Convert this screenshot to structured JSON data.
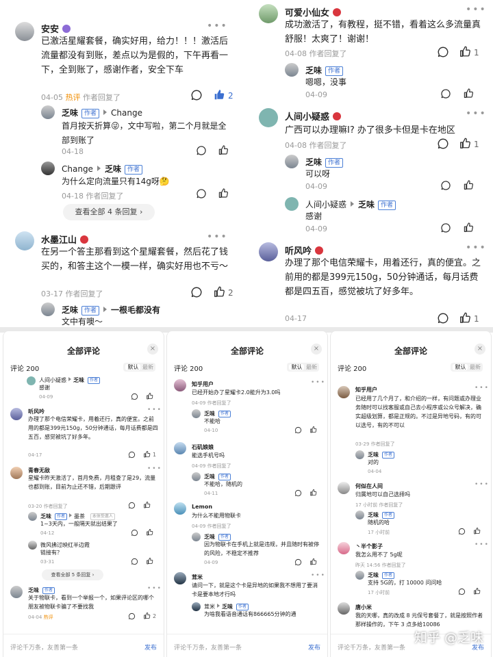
{
  "top_left": {
    "c1": {
      "name": "安安",
      "text": "已激活星耀套餐，确实好用，给力！！！激活后流量都没有到账，差点以为是假的，下午再看一下，全到账了，感谢作者，安全下车",
      "date": "04-05",
      "hot": "热评",
      "replied": "作者回复了",
      "likes": "2"
    },
    "r1": {
      "from": "乏味",
      "badge": "作者",
      "to": "Change",
      "text": "首月按天折算😜，文中写啦，第二个月就是全部到账了",
      "date": "04-18"
    },
    "r2": {
      "from": "Change",
      "to": "乏味",
      "badge": "作者",
      "text": "为什么定向流量只有14g呀🤔",
      "date": "04-18",
      "replied": "作者回复了"
    },
    "view_all": "查看全部 4 条回复",
    "c2": {
      "name": "水墨江山",
      "text": "在另一个答主那看到这个星耀套餐，然后花了钱买的，和答主这个一模一样，确实好用也不亏～",
      "date": "03-17",
      "replied": "作者回复了",
      "likes": "2"
    },
    "r3": {
      "from": "乏味",
      "badge": "作者",
      "to": "一根毛都没有",
      "text": "文中有噢～"
    }
  },
  "top_right": {
    "c1": {
      "name": "可爱小仙女",
      "text": "成功激活了，有教程，挺不错，看着这么多流量真舒服！太爽了！谢谢！",
      "date": "04-08",
      "replied": "作者回复了",
      "likes": "1"
    },
    "r1": {
      "from": "乏味",
      "badge": "作者",
      "text": "嗯嗯，没事",
      "date": "04-09"
    },
    "c2": {
      "name": "人间小疑惑",
      "text": "广西可以办理嘛I? 办了很多卡但是卡在地区",
      "date": "04-08",
      "replied": "作者回复了",
      "likes": "1"
    },
    "r2": {
      "from": "乏味",
      "badge": "作者",
      "text": "可以呀",
      "date": "04-09"
    },
    "r3": {
      "from": "人间小疑惑",
      "to": "乏味",
      "badge": "作者",
      "text": "感谢",
      "date": "04-09"
    },
    "c3": {
      "name": "听风吟",
      "text": "办理了那个电信荣耀卡，用着还行，真的便宜。之前用的都是399元150g，50分钟通话，每月话费都是四五百，感觉被坑了好多年。",
      "date": "04-17",
      "likes": "1"
    }
  },
  "panels": {
    "title": "全部评论",
    "count": "评论 200",
    "sort_default": "默认",
    "sort_latest": "最新",
    "input_placeholder": "评论千万条，友善第一条",
    "send": "发布",
    "close": "×",
    "p1": {
      "a": {
        "from": "人间小疑惑",
        "to": "乏味",
        "badge": "作者",
        "text": "感谢",
        "date": "04-09"
      },
      "b": {
        "name": "听风吟",
        "text": "办理了那个电信荣耀卡，用着还行，真的便宜。之前用的都是399元150g，50分钟通话，每月话费都是四五百，感觉被坑了好多年。",
        "date": "04-17",
        "likes": "1"
      },
      "c": {
        "name": "青春无敌",
        "text": "星耀卡昨天激活了，首月免费，月租查了是29，流量也都到账，目前为止还不错，后期跟评",
        "date": "03-20",
        "replied": "作者回复了"
      },
      "d": {
        "from": "乏味",
        "badge": "作者",
        "to": "墨茶",
        "extra": "本体受邀人",
        "text": "1~3天内，一般隔天就出结果了",
        "date": "04-12"
      },
      "e": {
        "name": "微风拂过映红半边霞",
        "text": "链接有？",
        "date": "03-31"
      },
      "view_all": "查看全部 5 条回复",
      "f": {
        "name": "乏味",
        "badge": "作者",
        "text": "关于物联卡，看到一个举报一个，如果评论区的哪个朋友被物联卡骗了不要找我",
        "date": "04-04",
        "hot": "热评",
        "likes": "2"
      }
    },
    "p2": {
      "a": {
        "name": "知乎用户",
        "text": "已经开始办了星耀卡2.0能升为3.0吗",
        "date": "04-09",
        "replied": "作者回复了"
      },
      "b": {
        "name": "乏味",
        "badge": "作者",
        "text": "不能哈",
        "date": "04-10"
      },
      "c": {
        "name": "石矶娘娘",
        "text": "能选手机号吗",
        "date": "04-09",
        "replied": "作者回复了"
      },
      "d": {
        "name": "乏味",
        "badge": "作者",
        "text": "不能哈，随机的",
        "date": "04-11"
      },
      "e": {
        "name": "Lemon",
        "text": "为什么不能用物联卡",
        "date": "04-09",
        "replied": "作者回复了"
      },
      "f": {
        "name": "乏味",
        "badge": "作者",
        "text": "因为物联卡在手机上就是违规，并且随时有被停的风险，不稳定不推荐",
        "date": "04-09"
      },
      "g": {
        "name": "茸米",
        "text": "请问一下，就是这个卡是异地的如果我不想用了要消卡是要本地才行吗"
      },
      "h": {
        "from": "茸米",
        "to": "乏味",
        "badge": "作者",
        "text": "为啥我看语音通话有866665分钟的通"
      }
    },
    "p3": {
      "a": {
        "name": "知乎用户",
        "text": "已经用了几个月了，和介绍的一样，有问题或办理业务随时可以找客服或自己去小程序或公众号解决，确实超级划算，都是正规的。不过是异地号码，有的可以选号，有的不可以",
        "date": "03-29",
        "replied": "作者回复了"
      },
      "b": {
        "name": "乏味",
        "badge": "作者",
        "text": "对的",
        "date": "04-04"
      },
      "c": {
        "name": "何似在人间",
        "text": "归属地可以自己选择吗",
        "date": "17 小时前",
        "replied": "作者回复了"
      },
      "d": {
        "name": "乏味",
        "badge": "作者",
        "text": "随机的哈",
        "date": "17 小时前"
      },
      "e": {
        "name": "丶半个影子",
        "text": "我怎么用不了 5g呢",
        "date": "昨天 14:56",
        "replied": "作者回复了"
      },
      "f": {
        "name": "乏味",
        "badge": "作者",
        "text": "支持 5G的，打 10000 问问哈",
        "date": "17 小时前"
      },
      "g": {
        "name": "唐小米",
        "text": "我的天哪，真的改成 8 元保号套餐了，就是按照作者那样操作的，下午 3 点多给10086"
      }
    }
  },
  "watermark": "知乎 @乏味",
  "colors": {
    "accent": "#3b6fd0",
    "hot": "#f08c00",
    "level_badge": "#d9363e"
  }
}
